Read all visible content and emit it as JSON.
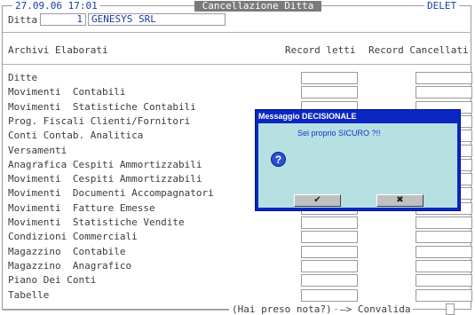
{
  "header": {
    "date_time": "27.09.06 17:01",
    "title": "Cancellazione Ditta",
    "mode": "DELET"
  },
  "company": {
    "label": "Ditta",
    "code": "1",
    "name": "GENESYS SRL"
  },
  "columns": {
    "archives": "Archivi Elaborati",
    "read": "Record letti",
    "deleted": "Record Cancellati"
  },
  "rows": [
    "Ditte",
    "Movimenti  Contabili",
    "Movimenti  Statistiche Contabili",
    "Prog. Fiscali Clienti/Fornitori",
    "Conti Contab. Analitica",
    "Versamenti",
    "Anagrafica Cespiti Ammortizzabili",
    "Movimenti  Cespiti Ammortizzabili",
    "Movimenti  Documenti Accompagnatori",
    "Movimenti  Fatture Emesse",
    "Movimenti  Statistiche Vendite",
    "Condizioni Commerciali",
    "Magazzino  Contabile",
    "Magazzino  Anagrafico",
    "Piano Dei Conti",
    "Tabelle"
  ],
  "footer": {
    "prompt": "(Hai preso nota?) ",
    "arrow": "—> Convalida"
  },
  "dialog": {
    "title": "Messaggio DECISIONALE",
    "message": "Sei proprio SICURO ?!!",
    "icon": "question-icon",
    "ok_glyph": "✔",
    "cancel_glyph": "✖"
  },
  "colors": {
    "dialog_frame": "#0a27c2",
    "dialog_body": "#b7e0e3",
    "title_bar": "#7b7b7b",
    "text_blue": "#1a3ca0"
  }
}
